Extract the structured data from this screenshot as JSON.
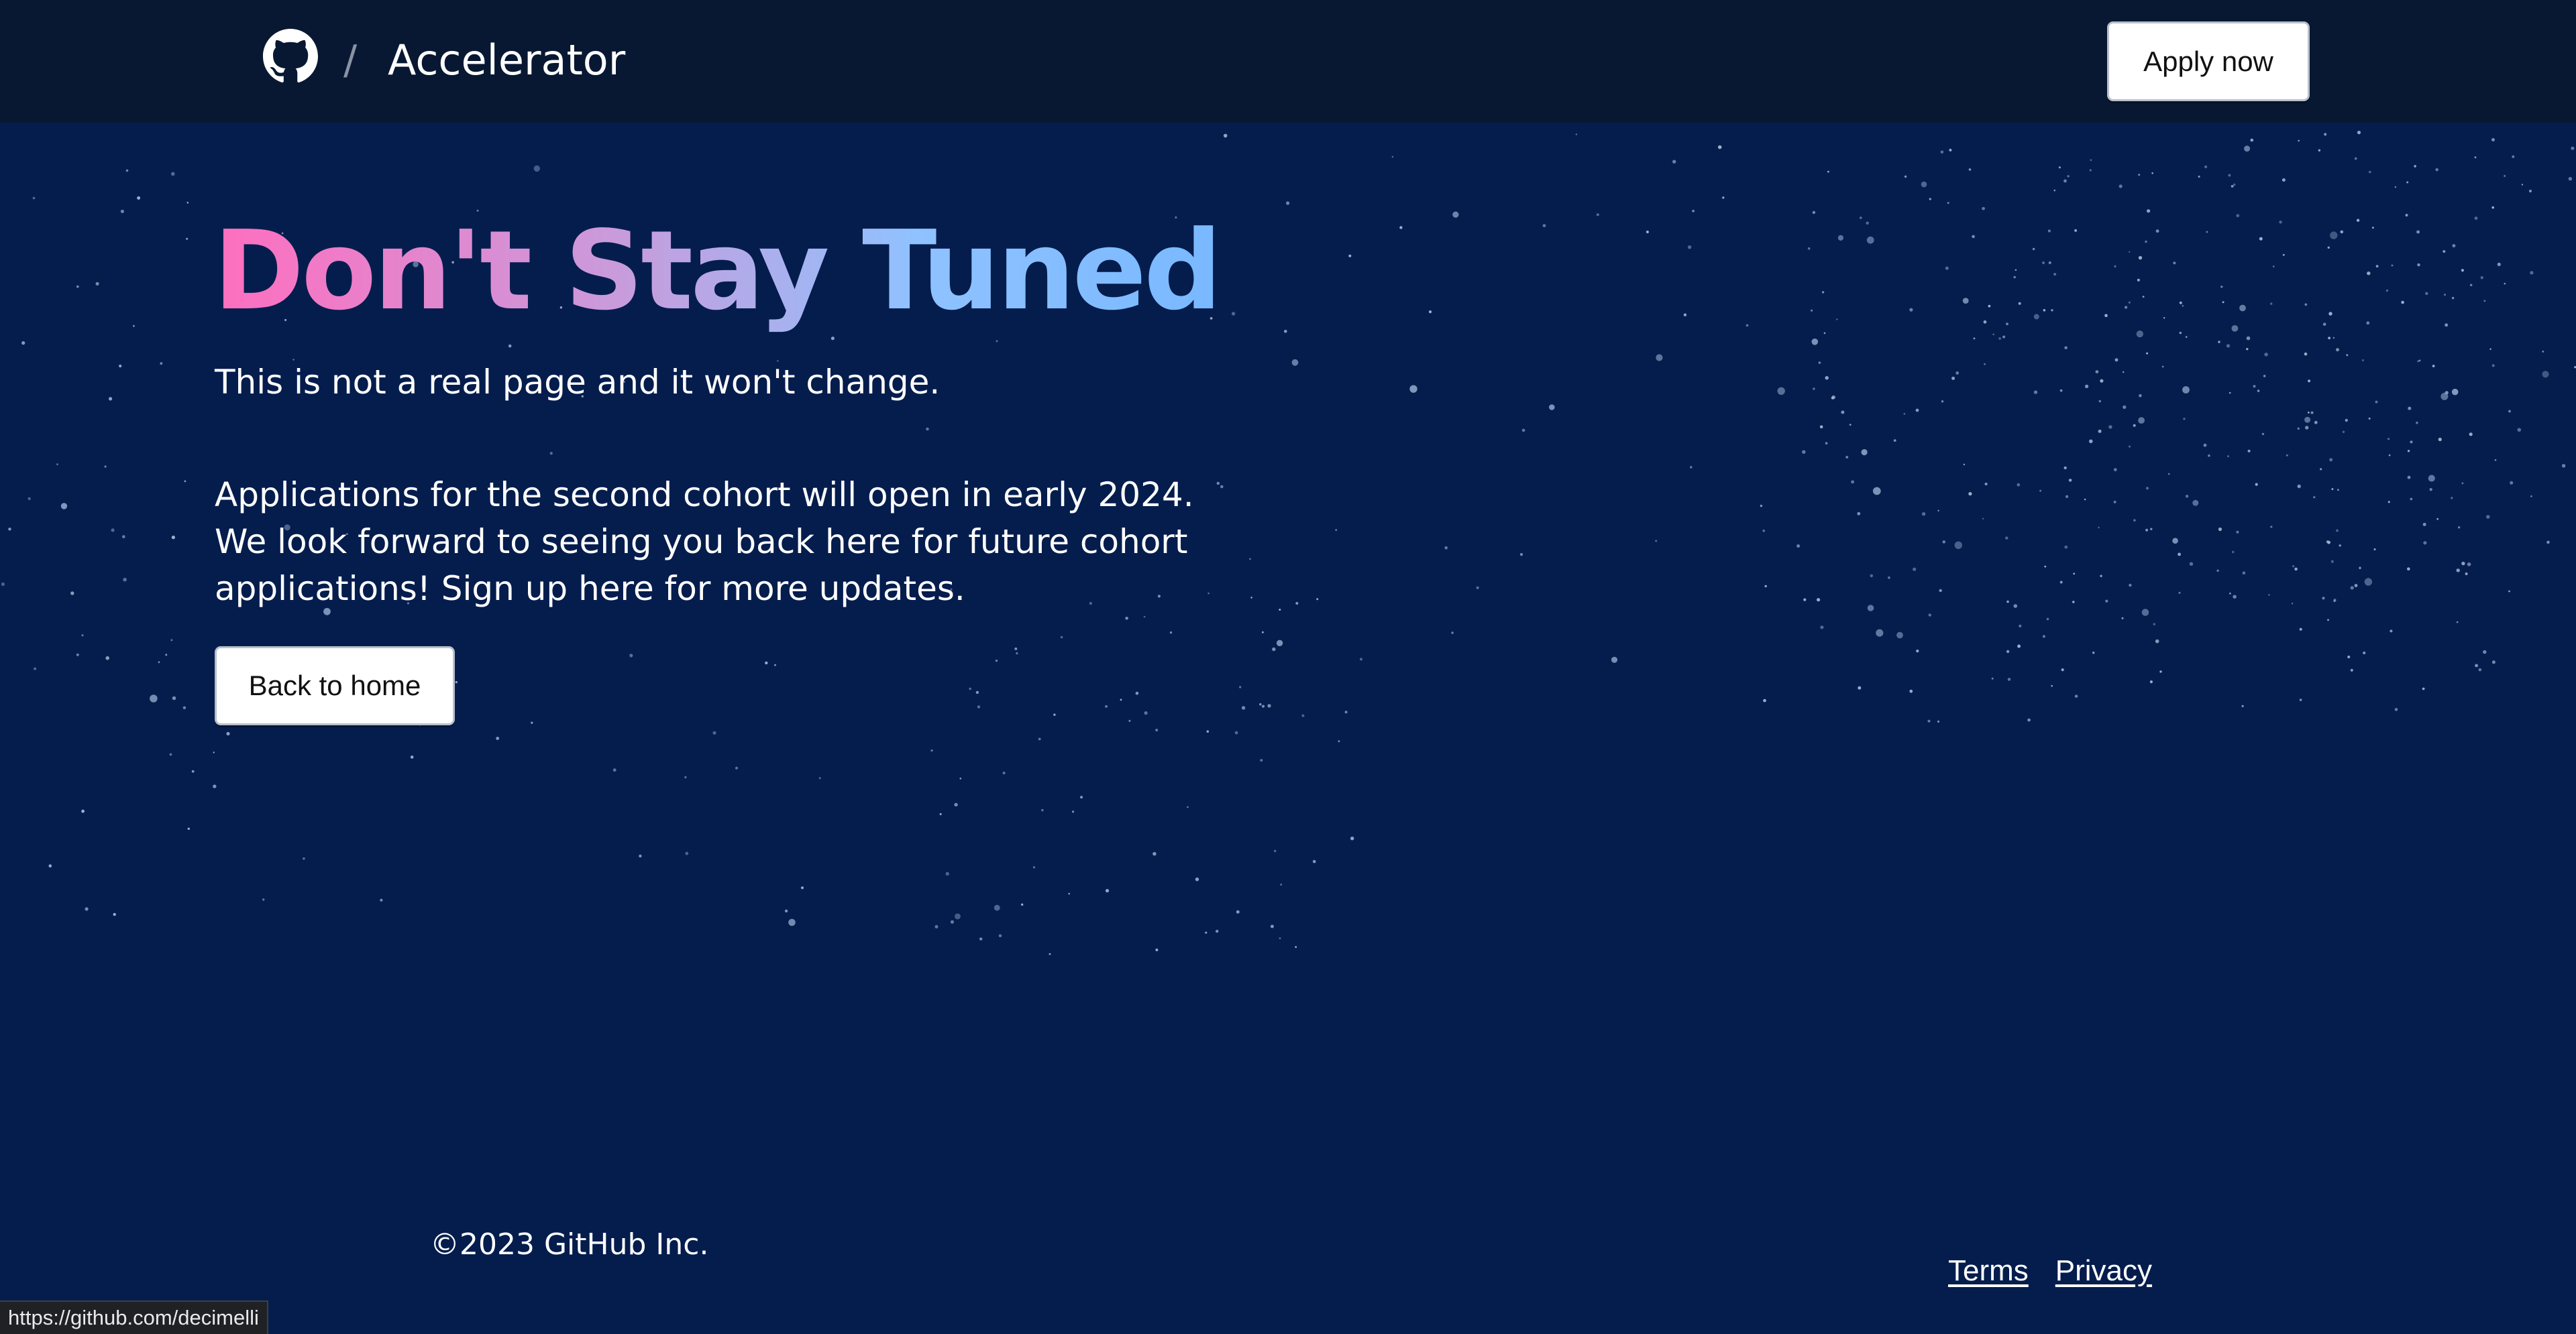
{
  "header": {
    "logo_icon": "github-mark-icon",
    "separator": "/",
    "brand": "Accelerator",
    "apply_label": "Apply now"
  },
  "hero": {
    "title": "Don't Stay Tuned",
    "subtitle": "This is not a real page and it won't change.",
    "body": "Applications for the second cohort will open in early 2024. We look forward to seeing you back here for future cohort applications! Sign up here for more updates.",
    "back_label": "Back to home"
  },
  "footer": {
    "copyright": "©2023 GitHub Inc.",
    "links": [
      "Terms",
      "Privacy"
    ]
  },
  "status_bar": {
    "url": "https://github.com/decimelli"
  },
  "colors": {
    "background": "#051d4d",
    "header": "#091832",
    "title_gradient_start": "#ff6ebf",
    "title_gradient_end": "#79b8ff"
  }
}
